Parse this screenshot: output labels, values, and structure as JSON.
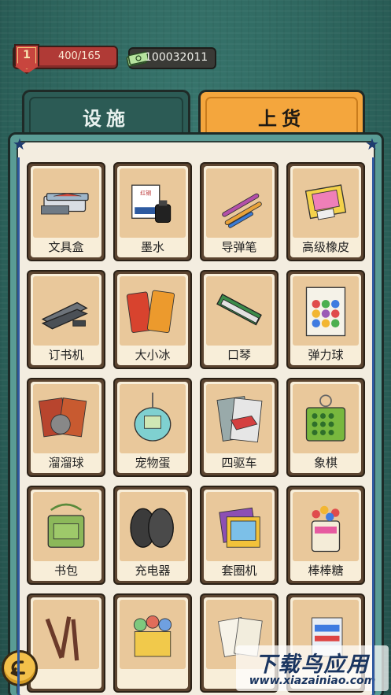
{
  "hud": {
    "level": "1",
    "xp": "400/165",
    "money": "100032011"
  },
  "tabs": [
    {
      "label": "设施",
      "active": false
    },
    {
      "label": "上货",
      "active": true
    }
  ],
  "items": [
    {
      "label": "文具盒",
      "icon": "pencil-case-icon"
    },
    {
      "label": "墨水",
      "icon": "ink-bottle-icon"
    },
    {
      "label": "导弹笔",
      "icon": "pen-icon"
    },
    {
      "label": "高级橡皮",
      "icon": "eraser-icon"
    },
    {
      "label": "订书机",
      "icon": "stapler-icon"
    },
    {
      "label": "大小冰",
      "icon": "ice-pop-icon"
    },
    {
      "label": "口琴",
      "icon": "harmonica-icon"
    },
    {
      "label": "弹力球",
      "icon": "bouncy-ball-icon"
    },
    {
      "label": "溜溜球",
      "icon": "yoyo-icon"
    },
    {
      "label": "宠物蛋",
      "icon": "tamagotchi-icon"
    },
    {
      "label": "四驱车",
      "icon": "toy-car-icon"
    },
    {
      "label": "象棋",
      "icon": "chess-icon"
    },
    {
      "label": "书包",
      "icon": "school-bag-icon"
    },
    {
      "label": "充电器",
      "icon": "charger-icon"
    },
    {
      "label": "套圈机",
      "icon": "ring-toss-icon"
    },
    {
      "label": "棒棒糖",
      "icon": "lollipop-icon"
    },
    {
      "label": "",
      "icon": "pencils-icon"
    },
    {
      "label": "",
      "icon": "figurines-icon"
    },
    {
      "label": "",
      "icon": "paper-icon"
    },
    {
      "label": "",
      "icon": "box-icon"
    }
  ],
  "watermark": {
    "title": "下载鸟应用",
    "url": "www.xiazainiao.com"
  },
  "colors": {
    "background": "#2f6b63",
    "tab_active": "#f4a63d",
    "tab_inactive": "#2c5b55",
    "card_frame": "#5b4430",
    "card_image_bg": "#e9c89b",
    "level_bar": "#b03a36"
  }
}
